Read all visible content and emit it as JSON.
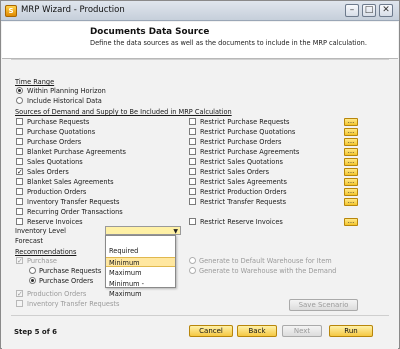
{
  "window": {
    "title": "MRP Wizard - Production",
    "app_icon_glyph": "S",
    "minimize_glyph": "–",
    "maximize_glyph": "□",
    "close_glyph": "✕"
  },
  "header": {
    "title": "Documents Data Source",
    "subtitle": "Define the data sources as well as the documents to include in the MRP calculation."
  },
  "time_range": {
    "label": "Time Range",
    "options": [
      {
        "label": "Within Planning Horizon",
        "selected": true
      },
      {
        "label": "Include Historical Data",
        "selected": false
      }
    ]
  },
  "sources": {
    "label": "Sources of Demand and Supply to Be Included in MRP Calculation",
    "left": [
      {
        "label": "Purchase Requests",
        "checked": false
      },
      {
        "label": "Purchase Quotations",
        "checked": false
      },
      {
        "label": "Purchase Orders",
        "checked": false
      },
      {
        "label": "Blanket Purchase Agreements",
        "checked": false
      },
      {
        "label": "Sales Quotations",
        "checked": false
      },
      {
        "label": "Sales Orders",
        "checked": true
      },
      {
        "label": "Blanket Sales Agreements",
        "checked": false
      },
      {
        "label": "Production Orders",
        "checked": false
      },
      {
        "label": "Inventory Transfer Requests",
        "checked": false
      },
      {
        "label": "Recurring Order Transactions",
        "checked": false
      },
      {
        "label": "Reserve Invoices",
        "checked": false
      }
    ],
    "right": [
      {
        "label": "Restrict Purchase Requests",
        "checked": false
      },
      {
        "label": "Restrict Purchase Quotations",
        "checked": false
      },
      {
        "label": "Restrict Purchase Orders",
        "checked": false
      },
      {
        "label": "Restrict Purchase Agreements",
        "checked": false
      },
      {
        "label": "Restrict Sales Quotations",
        "checked": false
      },
      {
        "label": "Restrict Sales Orders",
        "checked": false
      },
      {
        "label": "Restrict Sales Agreements",
        "checked": false
      },
      {
        "label": "Restrict Production Orders",
        "checked": false
      },
      {
        "label": "Restrict Transfer Requests",
        "checked": false
      },
      {
        "label": "Restrict Reserve Invoices",
        "checked": false
      }
    ],
    "ellipsis": "..."
  },
  "inventory_level": {
    "label": "Inventory Level",
    "value": "",
    "arrow": "▼",
    "options": [
      "Required",
      "Minimum",
      "Maximum",
      "Minimum - Maximum"
    ],
    "highlighted": "Minimum"
  },
  "forecast": {
    "label": "Forecast"
  },
  "recommendations": {
    "label": "Recommendations",
    "purchase": {
      "label": "Purchase",
      "checked": true
    },
    "purchase_requests": "Purchase Requests",
    "purchase_orders": "Purchase Orders",
    "production_orders": "Production Orders",
    "inventory_transfer_requests": "Inventory Transfer Requests",
    "generate_default_warehouse": "Generate to Default Warehouse for Item",
    "generate_warehouse_demand": "Generate to Warehouse with the Demand",
    "check_mark": "✓"
  },
  "buttons": {
    "save_scenario": "Save Scenario",
    "cancel": "Cancel",
    "back": "Back",
    "next": "Next",
    "run": "Run"
  },
  "step": "Step 5 of 6",
  "colors": {
    "accent_button": "#f5c842",
    "combo_bg": "#fff1a6"
  }
}
